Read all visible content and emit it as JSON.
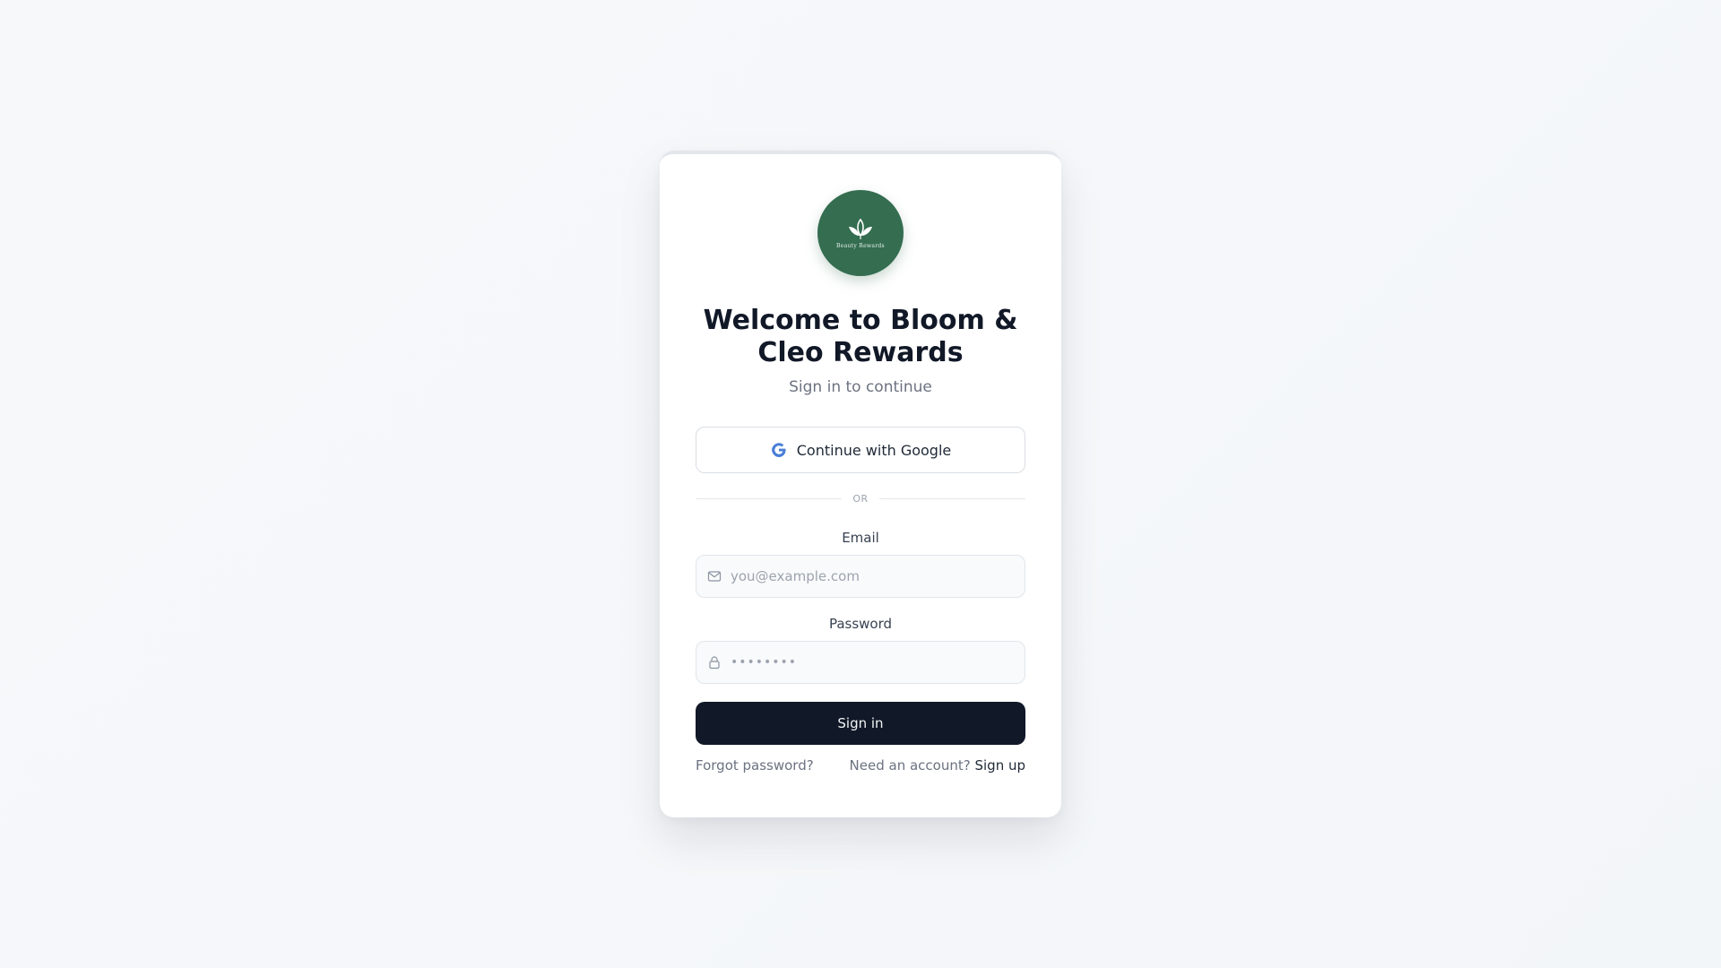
{
  "brand": {
    "logo_text": "Beauty Rewards",
    "logo_color": "#346d50"
  },
  "header": {
    "title": "Welcome to Bloom & Cleo Rewards",
    "subtitle": "Sign in to continue"
  },
  "google": {
    "label": "Continue with Google",
    "icon": "google-g-icon"
  },
  "divider": {
    "label": "OR"
  },
  "email": {
    "label": "Email",
    "placeholder": "you@example.com",
    "value": "",
    "icon": "mail-icon"
  },
  "password": {
    "label": "Password",
    "masked_value": "••••••••",
    "icon": "lock-icon"
  },
  "actions": {
    "signin_label": "Sign in",
    "forgot_label": "Forgot password?",
    "need_account_label": "Need an account?",
    "signup_label": "Sign up"
  },
  "colors": {
    "primary_button": "#111827",
    "accent_green": "#346d50",
    "google_blue": "#4a7fd8"
  }
}
